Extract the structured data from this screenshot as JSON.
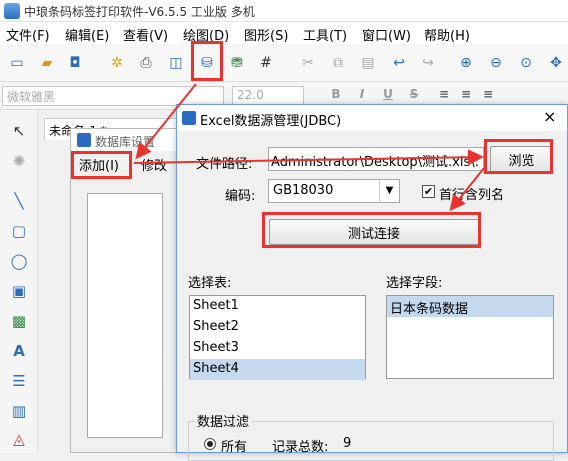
{
  "app": {
    "title": "中琅条码标签打印软件-V6.5.5 工业版 多机"
  },
  "menu": [
    "文件(F)",
    "编辑(E)",
    "查看(V)",
    "绘图(D)",
    "图形(S)",
    "工具(T)",
    "窗口(W)",
    "帮助(H)"
  ],
  "format_bar": {
    "font_name": "微软雅黑",
    "font_size": "22.0",
    "bold": "B",
    "italic": "I",
    "underline": "U",
    "strike": "S"
  },
  "doc_tab": {
    "label": "未命名-1 *"
  },
  "db_window": {
    "title": "数据库设置",
    "add_button": "添加(I)",
    "edit_button": "修改"
  },
  "excel_dialog": {
    "title": "Excel数据源管理(JDBC)",
    "close": "×",
    "file_path_label": "文件路径:",
    "file_path_value": ":\\Administrator\\Desktop\\测试.xls",
    "browse_button": "浏览",
    "encoding_label": "编码:",
    "encoding_value": "GB18030",
    "header_checkbox_label": "首行含列名",
    "header_checked": true,
    "test_button": "测试连接",
    "select_table_label": "选择表:",
    "tables": [
      "Sheet1",
      "Sheet2",
      "Sheet3",
      "Sheet4"
    ],
    "selected_table": "Sheet4",
    "select_field_label": "选择字段:",
    "fields": [
      "日本条码数据"
    ],
    "filter_label": "数据过滤",
    "filter_all_label": "所有",
    "record_count_label": "记录总数:",
    "record_count": "9"
  },
  "colors": {
    "highlight": "#e8332f",
    "selection": "#c4d8ee",
    "accent": "#2b6cc0"
  }
}
